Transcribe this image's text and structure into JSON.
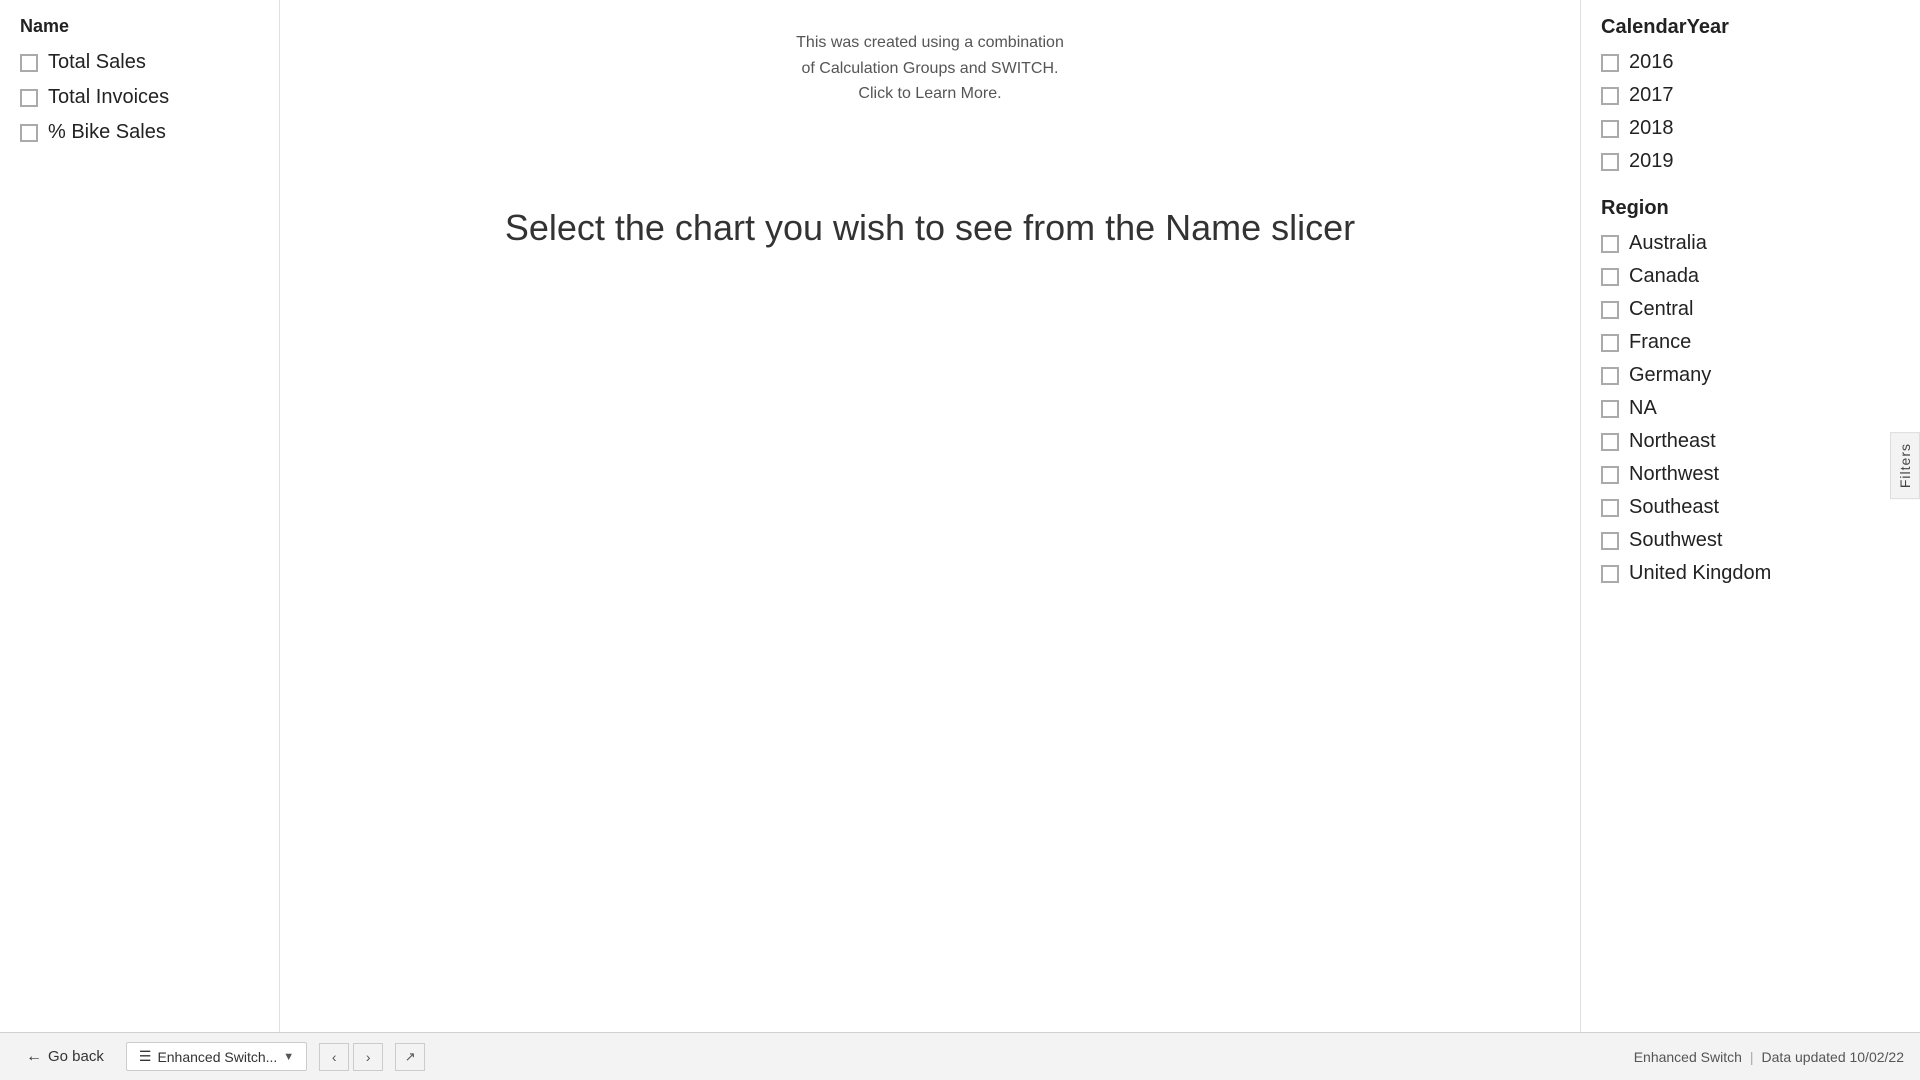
{
  "left_panel": {
    "title": "Name",
    "items": [
      {
        "label": "Total Sales",
        "checked": false
      },
      {
        "label": "Total Invoices",
        "checked": false
      },
      {
        "label": "% Bike Sales",
        "checked": false
      }
    ]
  },
  "center": {
    "tooltip_line1": "This was created using a combination",
    "tooltip_line2": "of Calculation Groups and SWITCH.",
    "tooltip_link": "Click to Learn More.",
    "main_message": "Select the chart you wish to see from the Name slicer"
  },
  "right_panel": {
    "calendar_year_title": "CalendarYear",
    "calendar_years": [
      {
        "label": "2016",
        "checked": false
      },
      {
        "label": "2017",
        "checked": false
      },
      {
        "label": "2018",
        "checked": false
      },
      {
        "label": "2019",
        "checked": false
      }
    ],
    "region_title": "Region",
    "regions": [
      {
        "label": "Australia",
        "checked": false
      },
      {
        "label": "Canada",
        "checked": false
      },
      {
        "label": "Central",
        "checked": false
      },
      {
        "label": "France",
        "checked": false
      },
      {
        "label": "Germany",
        "checked": false
      },
      {
        "label": "NA",
        "checked": false
      },
      {
        "label": "Northeast",
        "checked": false
      },
      {
        "label": "Northwest",
        "checked": false
      },
      {
        "label": "Southeast",
        "checked": false
      },
      {
        "label": "Southwest",
        "checked": false
      },
      {
        "label": "United Kingdom",
        "checked": false
      }
    ]
  },
  "filters_tab": {
    "label": "Filters"
  },
  "toolbar": {
    "go_back_label": "Go back",
    "tab_label": "Enhanced Switch...",
    "status_label": "Enhanced Switch",
    "data_updated": "Data updated 10/02/22"
  }
}
